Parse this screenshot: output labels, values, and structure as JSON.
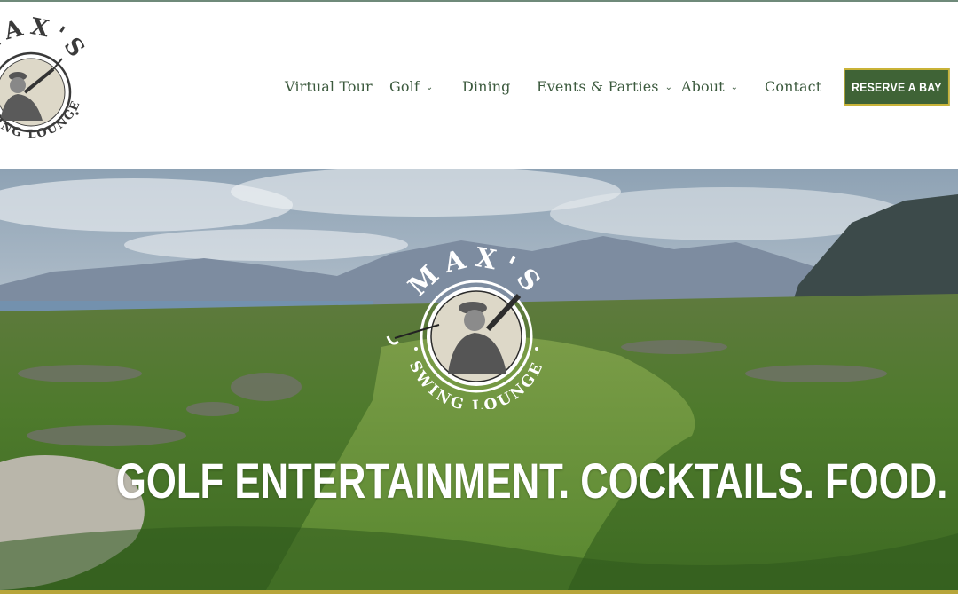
{
  "brand": {
    "name_top": "MAX'S",
    "name_bottom": "SWING LOUNGE",
    "logo_icon": "golfer-badge-icon"
  },
  "nav": {
    "items": [
      {
        "label": "Virtual Tour",
        "has_dropdown": false
      },
      {
        "label": "Golf",
        "has_dropdown": true
      },
      {
        "label": "Dining",
        "has_dropdown": false
      },
      {
        "label": "Events & Parties",
        "has_dropdown": true
      },
      {
        "label": "About",
        "has_dropdown": true
      },
      {
        "label": "Contact",
        "has_dropdown": false
      }
    ],
    "chevron": "⌄",
    "cta_label": "RESERVE A BAY"
  },
  "hero": {
    "tagline": "GOLF ENTERTAINMENT. COCKTAILS. FOOD."
  },
  "colors": {
    "nav_text": "#3c5a3e",
    "cta_bg": "#3f6336",
    "cta_border": "#c9b338",
    "accent_bar": "#b7a53a"
  }
}
